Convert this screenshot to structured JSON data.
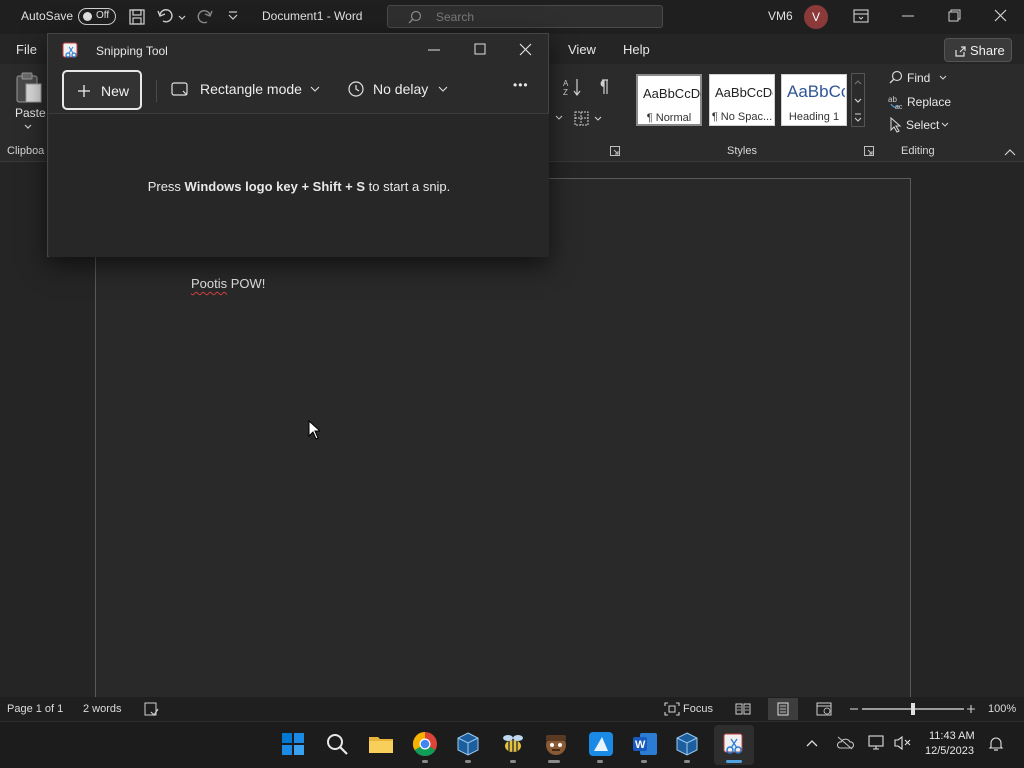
{
  "word": {
    "autosave_label": "AutoSave",
    "autosave_state": "Off",
    "doc_title": "Document1  -  Word",
    "search_placeholder": "Search",
    "user_name": "VM6",
    "avatar_initial": "V",
    "tabs": {
      "file": "File",
      "view": "View",
      "help": "Help"
    },
    "share_label": "Share",
    "paste_label": "Paste",
    "clipboard_label": "Clipboa",
    "styles": [
      {
        "sample": "AaBbCcDc",
        "name": "¶ Normal"
      },
      {
        "sample": "AaBbCcDc",
        "name": "¶ No Spac..."
      },
      {
        "sample": "AaBbCc",
        "name": "Heading 1"
      }
    ],
    "styles_label": "Styles",
    "editing": {
      "find": "Find",
      "replace": "Replace",
      "select": "Select",
      "label": "Editing"
    },
    "document_text": {
      "word1": "Pootis",
      "rest": " POW!"
    },
    "status": {
      "page": "Page 1 of 1",
      "words": "2 words",
      "focus": "Focus",
      "zoom": "100%",
      "zoom_level": 1.0
    }
  },
  "snipping_tool": {
    "title": "Snipping Tool",
    "new_label": "New",
    "mode_label": "Rectangle mode",
    "delay_label": "No delay",
    "more_label": "•••",
    "message": {
      "pre": "Press ",
      "keys": "Windows logo key + Shift + S",
      "post": " to start a snip."
    }
  },
  "taskbar": {
    "time": "11:43 AM",
    "date": "12/5/2023",
    "apps": [
      "start-icon",
      "search-icon",
      "file-explorer-icon",
      "chrome-icon",
      "virtualbox-icon",
      "app-bee-icon",
      "app-character-icon",
      "paint-icon",
      "word-icon",
      "virtualbox-icon",
      "snipping-tool-icon"
    ]
  },
  "colors": {
    "word_accent": "#185abd",
    "avatar": "#8b3a3a",
    "windows_blue": "#0078d4"
  }
}
